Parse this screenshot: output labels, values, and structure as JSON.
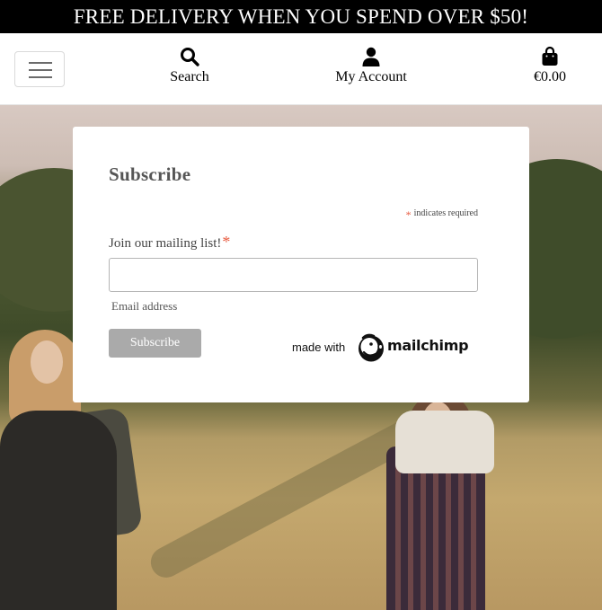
{
  "promo": {
    "text": "FREE DELIVERY WHEN YOU SPEND OVER $50!"
  },
  "nav": {
    "toggler_icon": "hamburger-icon",
    "search": {
      "label": "Search",
      "icon": "search-icon"
    },
    "account": {
      "label": "My Account",
      "icon": "user-icon"
    },
    "bag": {
      "label": "€0.00",
      "icon": "shopping-bag-icon"
    }
  },
  "subscribe": {
    "title": "Subscribe",
    "required_note": "indicates required",
    "required_mark": "*",
    "field_label": "Join our mailing list!",
    "email_value": "",
    "email_placeholder": "",
    "helper_text": "Email address",
    "button_label": "Subscribe",
    "badge": {
      "made_with": "made with",
      "brand": "mailchimp"
    }
  },
  "colors": {
    "promo_bg": "#000000",
    "required": "#e85c41",
    "button_bg": "#aaaaaa"
  }
}
